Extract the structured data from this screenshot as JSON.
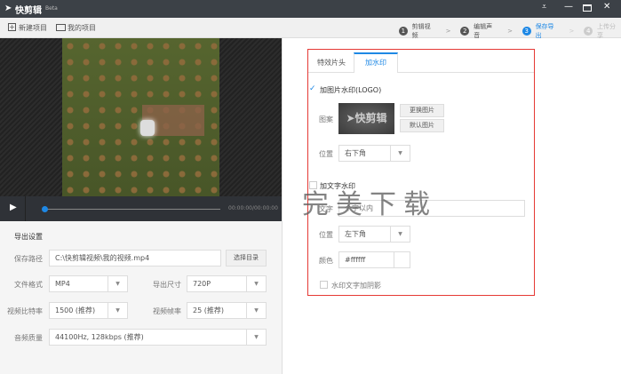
{
  "app": {
    "title": "快剪辑",
    "badge": "Beta"
  },
  "window_controls": [
    "menu-icon",
    "minimize-icon",
    "maximize-icon",
    "close-icon"
  ],
  "toolbar": {
    "new_project": "新建项目",
    "my_projects": "我的项目"
  },
  "steps": [
    {
      "num": "1",
      "label": "剪辑视频",
      "state": "done"
    },
    {
      "num": "2",
      "label": "编辑声音",
      "state": "done"
    },
    {
      "num": "3",
      "label": "保存导出",
      "state": "active"
    },
    {
      "num": "4",
      "label": "上传分享",
      "state": "disabled"
    }
  ],
  "colors": {
    "accent": "#1e88e5",
    "highlight_box": "#e53935"
  },
  "player": {
    "time": "00:00:00/00:00:00",
    "progress": 0
  },
  "export": {
    "title": "导出设置",
    "path_label": "保存路径",
    "path_value": "C:\\快剪辑视频\\我的视频.mp4",
    "choose_dir": "选择目录",
    "format_label": "文件格式",
    "format_value": "MP4",
    "size_label": "导出尺寸",
    "size_value": "720P",
    "bitrate_label": "视频比特率",
    "bitrate_value": "1500 (推荐)",
    "fps_label": "视频帧率",
    "fps_value": "25 (推荐)",
    "audio_label": "音频质量",
    "audio_value": "44100Hz, 128kbps (推荐)"
  },
  "watermark": {
    "tabs": [
      "特效片头",
      "加水印"
    ],
    "active_tab": 1,
    "image_check": "加图片水印(LOGO)",
    "image_checked": true,
    "pattern_label": "图案",
    "logo_text": "快剪辑",
    "replace_image": "更换图片",
    "default_image": "默认图片",
    "position_label": "位置",
    "image_position": "右下角",
    "text_check": "加文字水印",
    "text_checked": false,
    "text_label": "文字",
    "text_placeholder": "个字以内",
    "text_position_label": "位置",
    "text_position": "左下角",
    "color_label": "颜色",
    "color_value": "#ffffff",
    "shadow_check": "水印文字加阴影",
    "shadow_checked": false
  },
  "overlay_watermark": "完美下载"
}
